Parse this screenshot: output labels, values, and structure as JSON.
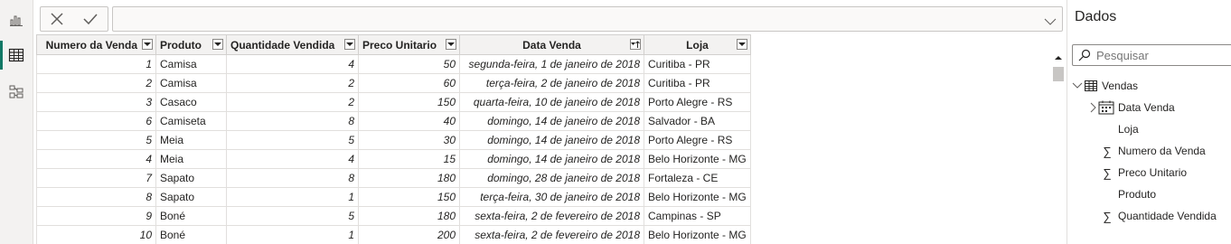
{
  "rail": {
    "icons": [
      "report-view-icon",
      "table-view-icon",
      "model-view-icon"
    ]
  },
  "formula": {
    "value": ""
  },
  "table": {
    "columns": [
      {
        "label": "Numero da Venda",
        "icon": "filter-dropdown-icon"
      },
      {
        "label": "Produto",
        "icon": "filter-dropdown-icon"
      },
      {
        "label": "Quantidade Vendida",
        "icon": "filter-dropdown-icon"
      },
      {
        "label": "Preco Unitario",
        "icon": "filter-dropdown-icon"
      },
      {
        "label": "Data Venda",
        "icon": "sort-ascending-icon"
      },
      {
        "label": "Loja",
        "icon": "filter-dropdown-icon"
      }
    ],
    "rows": [
      [
        "1",
        "Camisa",
        "4",
        "50",
        "segunda-feira, 1 de janeiro de 2018",
        "Curitiba - PR"
      ],
      [
        "2",
        "Camisa",
        "2",
        "60",
        "terça-feira, 2 de janeiro de 2018",
        "Curitiba - PR"
      ],
      [
        "3",
        "Casaco",
        "2",
        "150",
        "quarta-feira, 10 de janeiro de 2018",
        "Porto Alegre - RS"
      ],
      [
        "6",
        "Camiseta",
        "8",
        "40",
        "domingo, 14 de janeiro de 2018",
        "Salvador - BA"
      ],
      [
        "5",
        "Meia",
        "5",
        "30",
        "domingo, 14 de janeiro de 2018",
        "Porto Alegre - RS"
      ],
      [
        "4",
        "Meia",
        "4",
        "15",
        "domingo, 14 de janeiro de 2018",
        "Belo Horizonte - MG"
      ],
      [
        "7",
        "Sapato",
        "8",
        "180",
        "domingo, 28 de janeiro de 2018",
        "Fortaleza - CE"
      ],
      [
        "8",
        "Sapato",
        "1",
        "150",
        "terça-feira, 30 de janeiro de 2018",
        "Belo Horizonte - MG"
      ],
      [
        "9",
        "Boné",
        "5",
        "180",
        "sexta-feira, 2 de fevereiro de 2018",
        "Campinas - SP"
      ],
      [
        "10",
        "Boné",
        "1",
        "200",
        "sexta-feira, 2 de fevereiro de 2018",
        "Belo Horizonte - MG"
      ]
    ]
  },
  "data_pane": {
    "title": "Dados",
    "search_placeholder": "Pesquisar",
    "table_name": "Vendas",
    "fields": [
      {
        "label": "Data Venda",
        "icon": "calendar-hierarchy-icon",
        "expandable": true
      },
      {
        "label": "Loja",
        "icon": "",
        "expandable": false
      },
      {
        "label": "Numero da Venda",
        "icon": "sigma-icon",
        "expandable": false
      },
      {
        "label": "Preco Unitario",
        "icon": "sigma-icon",
        "expandable": false
      },
      {
        "label": "Produto",
        "icon": "",
        "expandable": false
      },
      {
        "label": "Quantidade Vendida",
        "icon": "sigma-icon",
        "expandable": false
      }
    ]
  },
  "colors": {
    "accent": "#117865",
    "header_bg": "#f3f2f1",
    "border": "#e1dfdd"
  }
}
